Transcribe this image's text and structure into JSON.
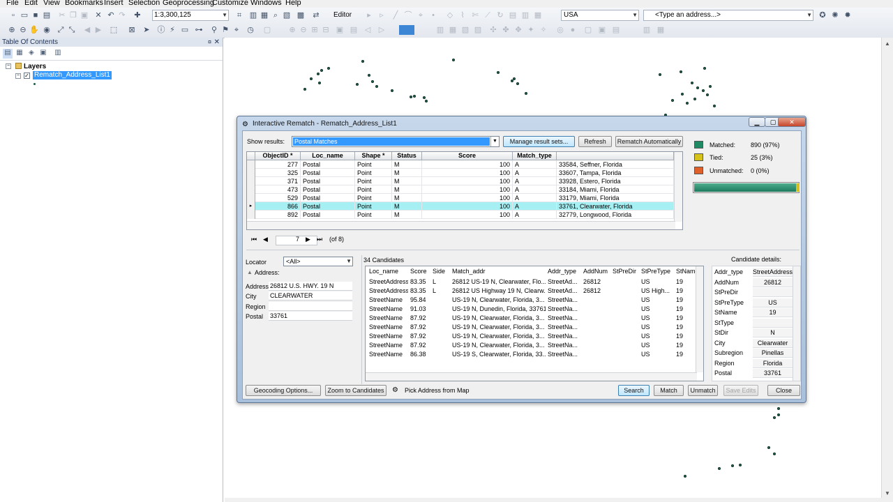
{
  "menu": [
    "File",
    "Edit",
    "View",
    "Bookmarks",
    "Insert",
    "Selection",
    "Geoprocessing",
    "Customize",
    "Windows",
    "Help"
  ],
  "toolbar": {
    "scale": "1:3,300,125",
    "editor_label": "Editor",
    "locator_region": "USA",
    "address_placeholder": "<Type an address...>"
  },
  "toc": {
    "title": "Table Of Contents",
    "pin_glyph": "¤",
    "close_glyph": "✕",
    "root_label": "Layers",
    "layer_name": "Rematch_Address_List1",
    "checked": "✓"
  },
  "dialog": {
    "title": "Interactive Rematch - Rematch_Address_List1",
    "show_results_label": "Show results:",
    "show_results_value": "Postal Matches",
    "buttons": {
      "manage": "Manage result sets...",
      "refresh": "Refresh",
      "rematch": "Rematch Automatically"
    },
    "summary": [
      {
        "label": "Matched:",
        "value": "890 (97%)",
        "color": "#1f8a64"
      },
      {
        "label": "Tied:",
        "value": "25 (3%)",
        "color": "#d5c21a"
      },
      {
        "label": "Unmatched:",
        "value": "0 (0%)",
        "color": "#e0602c"
      }
    ],
    "progress": {
      "matched_fraction": 0.97,
      "tied_fraction": 0.03
    },
    "results_columns": [
      "ObjectID *",
      "Loc_name",
      "Shape *",
      "Status",
      "Score",
      "Match_type",
      ""
    ],
    "results_rows": [
      {
        "id": "277",
        "loc": "Postal",
        "shape": "Point",
        "status": "M",
        "score": "100",
        "type": "A",
        "addr": "33584, Seffner, Florida"
      },
      {
        "id": "325",
        "loc": "Postal",
        "shape": "Point",
        "status": "M",
        "score": "100",
        "type": "A",
        "addr": "33607, Tampa, Florida"
      },
      {
        "id": "371",
        "loc": "Postal",
        "shape": "Point",
        "status": "M",
        "score": "100",
        "type": "A",
        "addr": "33928, Estero, Florida"
      },
      {
        "id": "473",
        "loc": "Postal",
        "shape": "Point",
        "status": "M",
        "score": "100",
        "type": "A",
        "addr": "33184, Miami, Florida"
      },
      {
        "id": "529",
        "loc": "Postal",
        "shape": "Point",
        "status": "M",
        "score": "100",
        "type": "A",
        "addr": "33179, Miami, Florida"
      },
      {
        "id": "866",
        "loc": "Postal",
        "shape": "Point",
        "status": "M",
        "score": "100",
        "type": "A",
        "addr": "33761, Clearwater, Florida",
        "selected": true
      },
      {
        "id": "892",
        "loc": "Postal",
        "shape": "Point",
        "status": "M",
        "score": "100",
        "type": "A",
        "addr": "32779, Longwood, Florida"
      }
    ],
    "navigator": {
      "current": "7",
      "total": "(of 8)"
    },
    "locator_label": "Locator",
    "locator_value": "<All>",
    "address_heading": "Address:",
    "address_fields": [
      {
        "label": "Address",
        "value": "26812 U.S. HWY. 19 N"
      },
      {
        "label": "City",
        "value": "CLEARWATER"
      },
      {
        "label": "Region",
        "value": ""
      },
      {
        "label": "Postal",
        "value": "33761"
      }
    ],
    "candidates_count": "34 Candidates",
    "candidate_columns": [
      "Loc_name",
      "Score",
      "Side",
      "Match_addr",
      "Addr_type",
      "AddNum",
      "StPreDir",
      "StPreType",
      "StName"
    ],
    "candidates": [
      [
        "StreetAddress",
        "83.35",
        "L",
        "26812 US-19 N, Clearwater, Flo...",
        "StreetAd...",
        "26812",
        "",
        "US",
        "19"
      ],
      [
        "StreetAddress",
        "83.35",
        "L",
        "26812 US Highway 19 N, Clearw...",
        "StreetAd...",
        "26812",
        "",
        "US High...",
        "19"
      ],
      [
        "StreetName",
        "95.84",
        "",
        "US-19 N, Clearwater, Florida, 3...",
        "StreetNa...",
        "",
        "",
        "US",
        "19"
      ],
      [
        "StreetName",
        "91.03",
        "",
        "US-19 N, Dunedin, Florida, 33761",
        "StreetNa...",
        "",
        "",
        "US",
        "19"
      ],
      [
        "StreetName",
        "87.92",
        "",
        "US-19 N, Clearwater, Florida, 3...",
        "StreetNa...",
        "",
        "",
        "US",
        "19"
      ],
      [
        "StreetName",
        "87.92",
        "",
        "US-19 N, Clearwater, Florida, 3...",
        "StreetNa...",
        "",
        "",
        "US",
        "19"
      ],
      [
        "StreetName",
        "87.92",
        "",
        "US-19 N, Clearwater, Florida, 3...",
        "StreetNa...",
        "",
        "",
        "US",
        "19"
      ],
      [
        "StreetName",
        "87.92",
        "",
        "US-19 N, Clearwater, Florida, 3...",
        "StreetNa...",
        "",
        "",
        "US",
        "19"
      ],
      [
        "StreetName",
        "86.38",
        "",
        "US-19 S, Clearwater, Florida, 33...",
        "StreetNa...",
        "",
        "",
        "US",
        "19"
      ]
    ],
    "details_title": "Candidate details:",
    "details": [
      {
        "key": "Addr_type",
        "value": "StreetAddress"
      },
      {
        "key": "AddNum",
        "value": "26812"
      },
      {
        "key": "StPreDir",
        "value": ""
      },
      {
        "key": "StPreType",
        "value": "US"
      },
      {
        "key": "StName",
        "value": "19"
      },
      {
        "key": "StType",
        "value": ""
      },
      {
        "key": "StDir",
        "value": "N"
      },
      {
        "key": "City",
        "value": "Clearwater"
      },
      {
        "key": "Subregion",
        "value": "Pinellas"
      },
      {
        "key": "Region",
        "value": "Florida"
      },
      {
        "key": "Postal",
        "value": "33761"
      }
    ],
    "bottom": {
      "geocoding": "Geocoding Options...",
      "zoom": "Zoom to Candidates",
      "pick": "Pick Address from Map",
      "search": "Search",
      "match": "Match",
      "unmatch": "Unmatch",
      "save": "Save Edits",
      "close": "Close"
    }
  },
  "colors": {
    "selection": "#3399ff",
    "selected_row": "#a6f0f3",
    "point": "#1e6a55"
  }
}
